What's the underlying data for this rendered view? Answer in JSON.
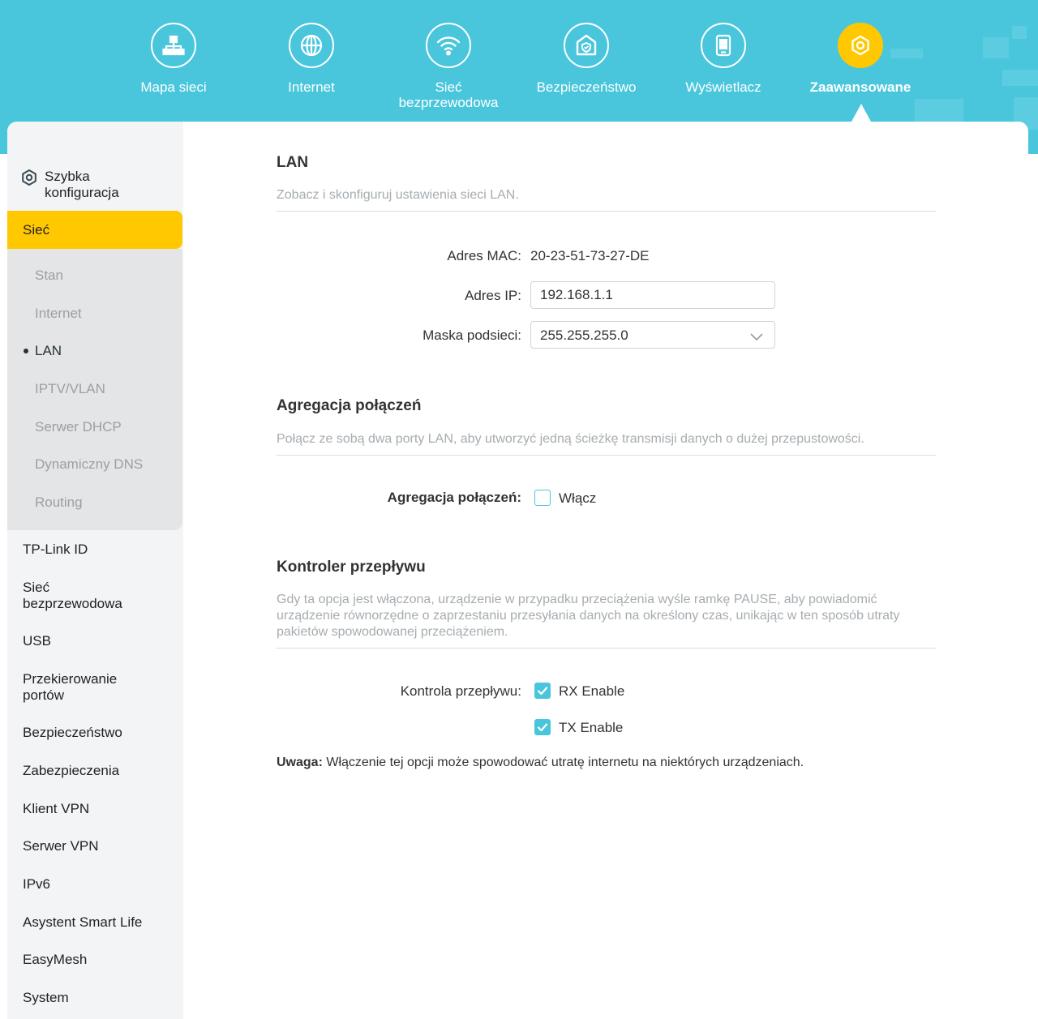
{
  "nav": {
    "items": [
      {
        "label": "Mapa sieci",
        "icon": "network-map-icon"
      },
      {
        "label": "Internet",
        "icon": "globe-icon"
      },
      {
        "label": "Sieć bezprzewodowa",
        "icon": "wifi-icon"
      },
      {
        "label": "Bezpieczeństwo",
        "icon": "shield-home-icon"
      },
      {
        "label": "Wyświetlacz",
        "icon": "display-icon"
      },
      {
        "label": "Zaawansowane",
        "icon": "gear-icon",
        "active": true
      }
    ]
  },
  "colors": {
    "accent": "#4ac6dc",
    "highlight": "#ffc800"
  },
  "sidebar": {
    "quick_setup": "Szybka konfiguracja",
    "network": "Sieć",
    "network_sub": [
      "Stan",
      "Internet",
      "LAN",
      "IPTV/VLAN",
      "Serwer DHCP",
      "Dynamiczny DNS",
      "Routing"
    ],
    "active_sub": "LAN",
    "items": [
      "TP-Link ID",
      "Sieć bezprzewodowa",
      "USB",
      "Przekierowanie portów",
      "Bezpieczeństwo",
      "Zabezpieczenia",
      "Klient VPN",
      "Serwer VPN",
      "IPv6",
      "Asystent Smart Life",
      "EasyMesh",
      "System"
    ]
  },
  "lan": {
    "title": "LAN",
    "description": "Zobacz i skonfiguruj ustawienia sieci LAN.",
    "mac_label": "Adres MAC:",
    "mac_value": "20-23-51-73-27-DE",
    "ip_label": "Adres IP:",
    "ip_value": "192.168.1.1",
    "mask_label": "Maska podsieci:",
    "mask_value": "255.255.255.0"
  },
  "aggregation": {
    "title": "Agregacja połączeń",
    "description": "Połącz ze sobą dwa porty LAN, aby utworzyć jedną ścieżkę transmisji danych o dużej przepustowości.",
    "label": "Agregacja połączeń:",
    "option": "Włącz",
    "checked": false
  },
  "flow": {
    "title": "Kontroler przepływu",
    "description": "Gdy ta opcja jest włączona, urządzenie w przypadku przeciążenia wyśle ramkę PAUSE, aby powiadomić urządzenie równorzędne o zaprzestaniu przesyłania danych na określony czas, unikając w ten sposób utraty pakietów spowodowanej przeciążeniem.",
    "label": "Kontrola przepływu:",
    "rx": "RX Enable",
    "tx": "TX Enable",
    "rx_checked": true,
    "tx_checked": true
  },
  "note": {
    "prefix": "Uwaga:",
    "text": " Włączenie tej opcji może spowodować utratę internetu na niektórych urządzeniach."
  }
}
